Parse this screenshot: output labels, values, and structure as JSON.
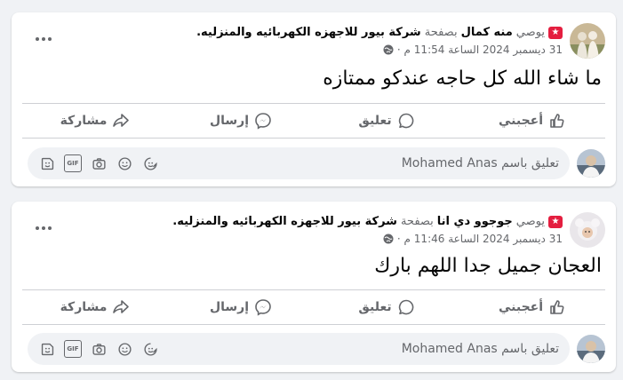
{
  "colors": {
    "background": "#f0f2f5",
    "card": "#ffffff",
    "muted": "#65676b",
    "badge": "#e41e3f",
    "divider": "#ced0d4"
  },
  "posts": [
    {
      "badge_icon": "star-badge-icon",
      "role": "يوصي",
      "author": "منه كمال",
      "page_prefix": "بصفحة",
      "page_name": "شركة بيور للاجهزه الكهربائيه والمنزليه",
      "timestamp": "31 ديسمبر 2024 الساعة 11:54 م ·",
      "text": "ما شاء الله كل حاجه عندكو ممتازه",
      "actions": {
        "like": "أعجبني",
        "comment": "تعليق",
        "send": "إرسال",
        "share": "مشاركة"
      },
      "comment_placeholder": "تعليق باسم Mohamed Anas"
    },
    {
      "badge_icon": "star-badge-icon",
      "role": "يوصي",
      "author": "جوجوو دي انا",
      "page_prefix": "بصفحة",
      "page_name": "شركة بيور للاجهزه الكهربائيه والمنزليه",
      "timestamp": "31 ديسمبر 2024 الساعة 11:46 م ·",
      "text": "العجان جميل جدا اللهم بارك",
      "actions": {
        "like": "أعجبني",
        "comment": "تعليق",
        "send": "إرسال",
        "share": "مشاركة"
      },
      "comment_placeholder": "تعليق باسم Mohamed Anas"
    }
  ]
}
